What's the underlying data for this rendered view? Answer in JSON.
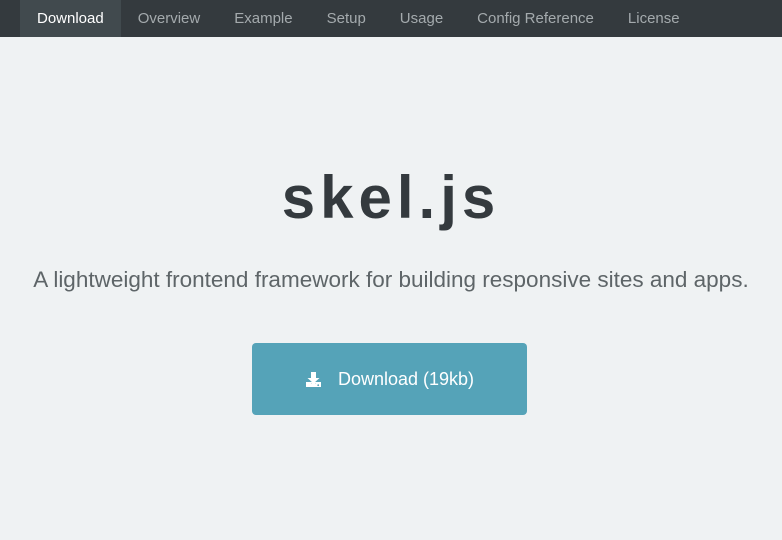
{
  "nav": {
    "items": [
      {
        "label": "Download",
        "active": true
      },
      {
        "label": "Overview"
      },
      {
        "label": "Example"
      },
      {
        "label": "Setup"
      },
      {
        "label": "Usage"
      },
      {
        "label": "Config Reference"
      },
      {
        "label": "License"
      }
    ]
  },
  "hero": {
    "title": "skel.js",
    "subtitle": "A lightweight frontend framework for building responsive sites and apps."
  },
  "download_button": {
    "label": "Download (19kb)",
    "icon": "download-icon"
  },
  "colors": {
    "nav_background": "#343a3e",
    "nav_active": "#414a4e",
    "page_background": "#eff2f3",
    "button_background": "#55a3b8",
    "title_text": "#343a3e"
  }
}
